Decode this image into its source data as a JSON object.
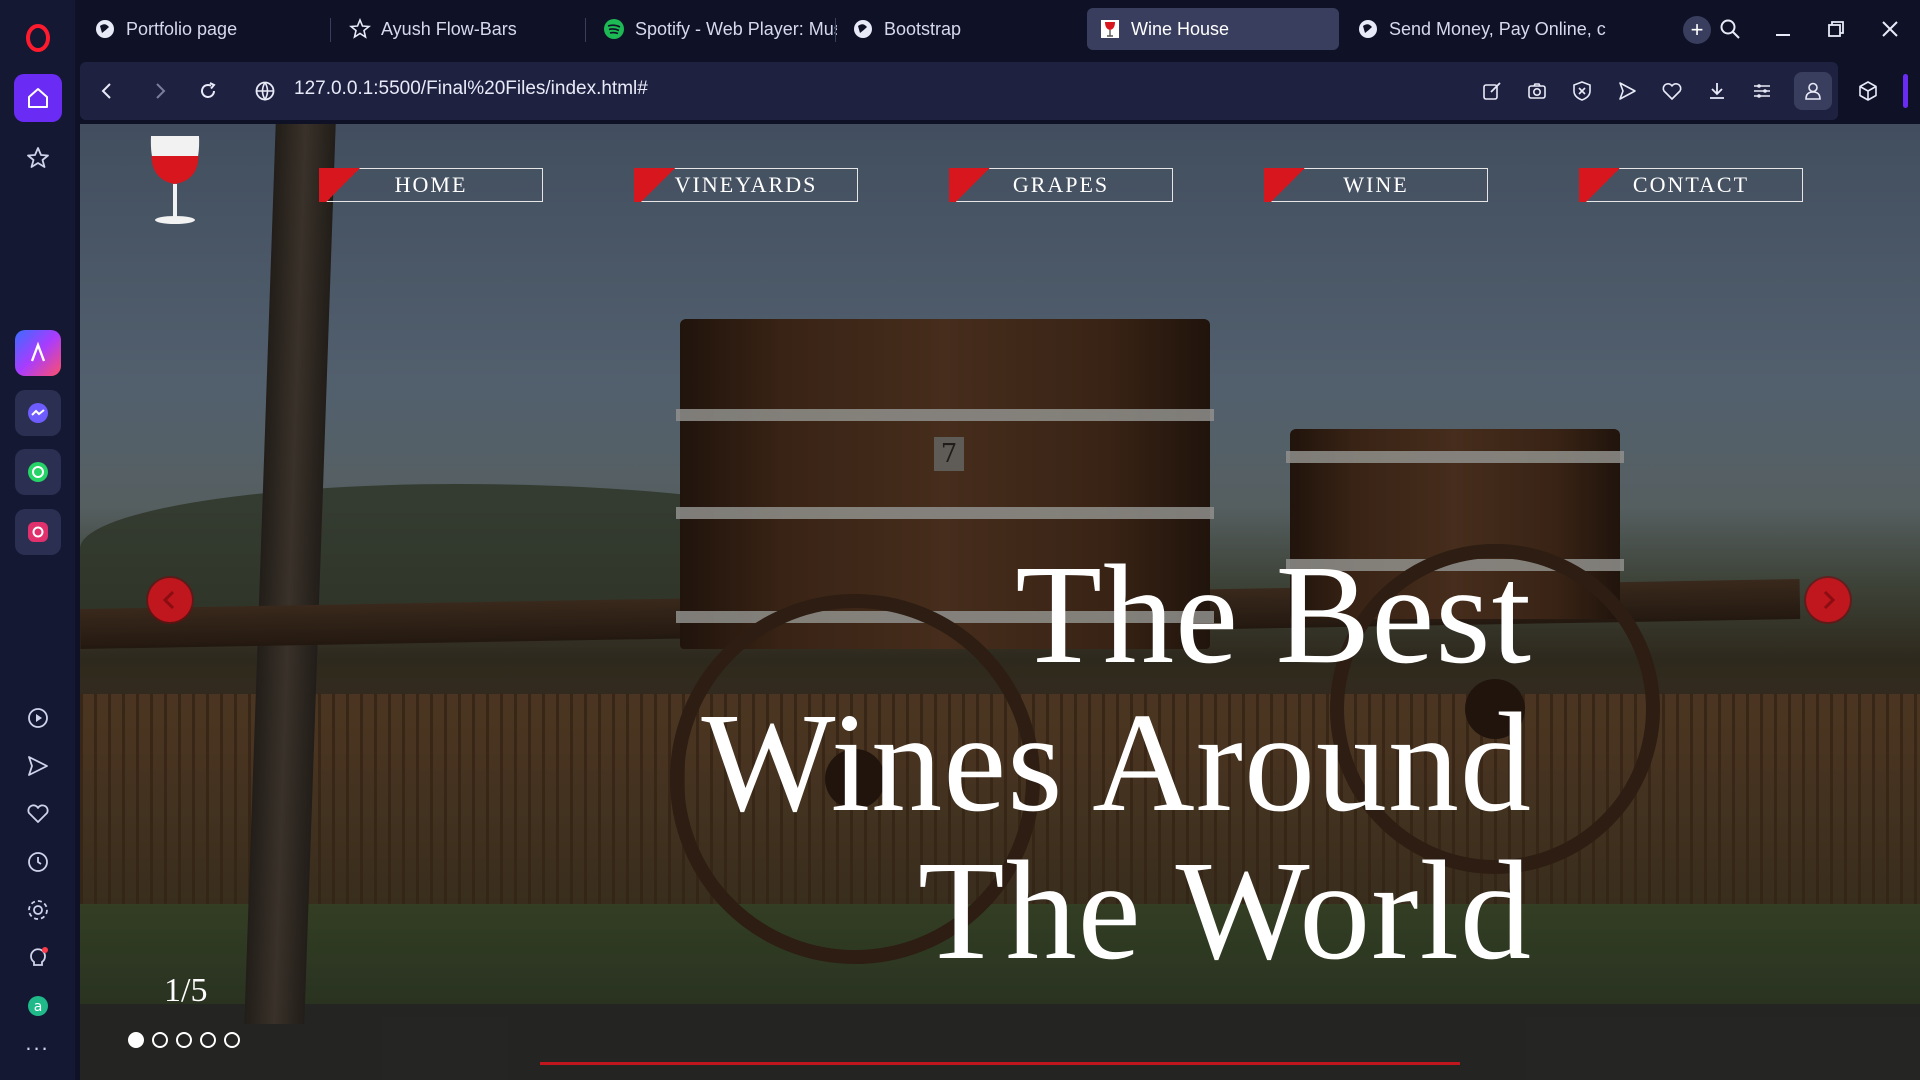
{
  "browser": {
    "tabs": [
      {
        "label": "Portfolio page",
        "icon": "globe-icon"
      },
      {
        "label": "Ayush Flow-Bars",
        "icon": "star-badge-icon"
      },
      {
        "label": "Spotify - Web Player: Mus",
        "icon": "spotify-icon"
      },
      {
        "label": "Bootstrap",
        "icon": "globe-icon"
      },
      {
        "label": "Wine House",
        "icon": "wine-glass-icon",
        "active": true
      },
      {
        "label": "Send Money, Pay Online, c",
        "icon": "globe-icon"
      }
    ],
    "new_tab_label": "+",
    "url": "127.0.0.1:5500/Final%20Files/index.html#",
    "accent_color": "#6a2cf5"
  },
  "sidebar": {
    "items": [
      "opera-logo-icon",
      "home-icon",
      "favorites-icon",
      "aria-icon",
      "messenger-icon",
      "whatsapp-icon",
      "instagram-icon",
      "player-icon",
      "send-icon",
      "heart-icon",
      "history-icon",
      "settings-icon",
      "tips-icon",
      "extension-a-icon"
    ],
    "more_label": "..."
  },
  "page": {
    "nav": [
      {
        "label": "HOME"
      },
      {
        "label": "VINEYARDS"
      },
      {
        "label": "GRAPES"
      },
      {
        "label": "WINE"
      },
      {
        "label": "CONTACT"
      }
    ],
    "barrel_number": "7",
    "headline": [
      "The Best",
      "Wines Around",
      "The World"
    ],
    "slider": {
      "counter": "1/5",
      "current": 1,
      "total": 5
    },
    "brand_color": "#c0161e"
  }
}
